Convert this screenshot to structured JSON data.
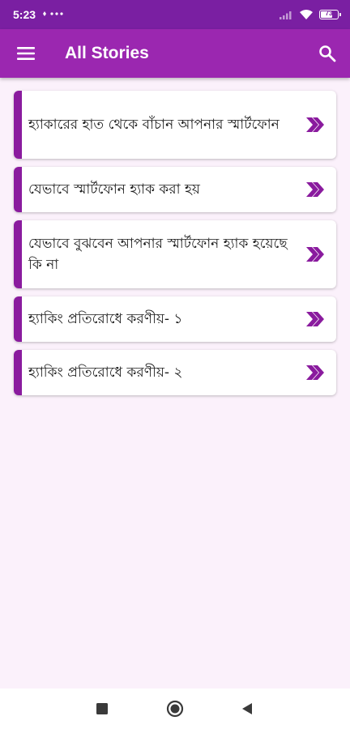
{
  "status_bar": {
    "time": "5:23",
    "extra": "ஏ •••",
    "battery": "73",
    "battery_level": 0.73
  },
  "app_bar": {
    "title": "All Stories",
    "menu_icon": "hamburger-menu-icon",
    "search_icon": "search-icon"
  },
  "colors": {
    "status_bar": "#7a1fa2",
    "app_bar": "#9b27b0",
    "accent": "#8a1b9e",
    "background": "#fbf1fb"
  },
  "stories": [
    {
      "title": "হ্যাকারের হাত থেকে বাঁচান আপনার স্মার্টফোন"
    },
    {
      "title": "যেভাবে স্মার্টফোন হ্যাক করা হয়"
    },
    {
      "title": "যেভাবে বুঝবেন আপনার স্মার্টফোন হ্যাক হয়েছে কি না"
    },
    {
      "title": "হ্যাকিং প্রতিরোধে করণীয়- ১"
    },
    {
      "title": "হ্যাকিং প্রতিরোধে করণীয়- ২"
    }
  ],
  "story_arrow_icon": "double-chevron-right-icon",
  "nav_bar": {
    "recents_icon": "square-recents-icon",
    "home_icon": "circle-home-icon",
    "back_icon": "triangle-back-icon"
  }
}
